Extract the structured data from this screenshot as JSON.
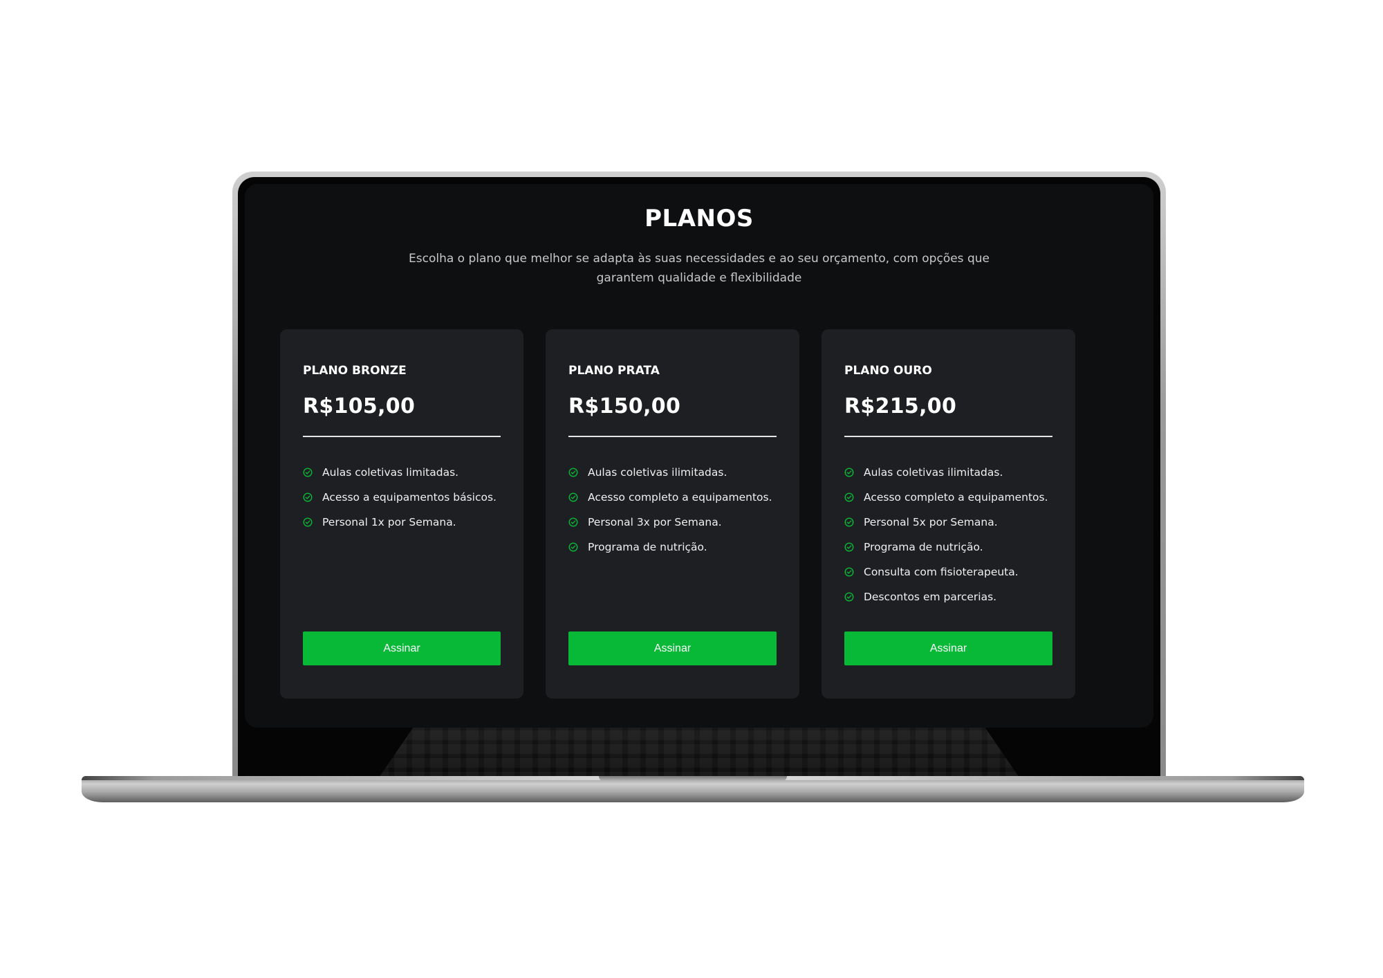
{
  "page": {
    "title": "PLANOS",
    "subtitle": "Escolha o plano que melhor se adapta às suas necessidades e ao seu orçamento, com opções que garantem qualidade e flexibilidade"
  },
  "plans": [
    {
      "name": "PLANO BRONZE",
      "price": "R$105,00",
      "features": [
        "Aulas coletivas limitadas.",
        "Acesso a equipamentos básicos.",
        "Personal 1x por Semana."
      ],
      "button_label": "Assinar"
    },
    {
      "name": "PLANO PRATA",
      "price": "R$150,00",
      "features": [
        "Aulas coletivas ilimitadas.",
        "Acesso completo a equipamentos.",
        "Personal 3x por Semana.",
        "Programa de nutrição."
      ],
      "button_label": "Assinar"
    },
    {
      "name": "PLANO OURO",
      "price": "R$215,00",
      "features": [
        "Aulas coletivas ilimitadas.",
        "Acesso completo a equipamentos.",
        "Personal 5x por Semana.",
        "Programa de nutrição.",
        "Consulta com fisioterapeuta.",
        "Descontos em parcerias."
      ],
      "button_label": "Assinar"
    }
  ],
  "colors": {
    "accent": "#07b936",
    "screen_background": "#0e0f11",
    "card_background": "#1e1f23"
  },
  "icons": {
    "feature_bullet": "check-circle-icon"
  }
}
